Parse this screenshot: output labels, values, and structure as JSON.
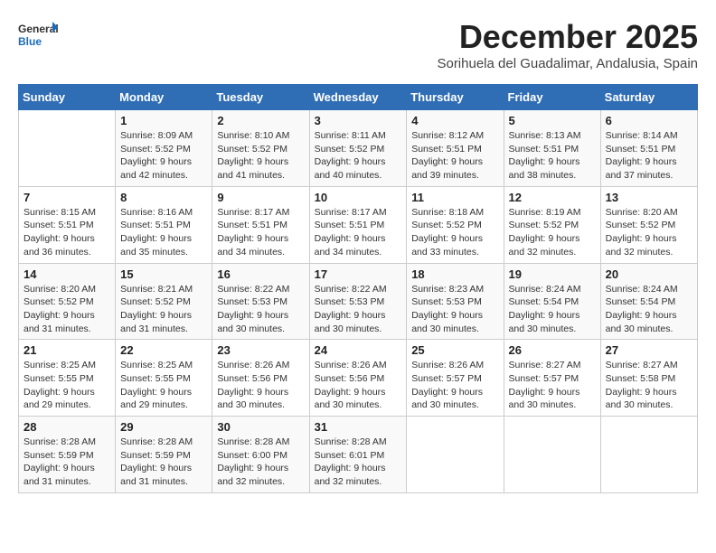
{
  "header": {
    "logo_general": "General",
    "logo_blue": "Blue",
    "month_title": "December 2025",
    "subtitle": "Sorihuela del Guadalimar, Andalusia, Spain"
  },
  "columns": [
    "Sunday",
    "Monday",
    "Tuesday",
    "Wednesday",
    "Thursday",
    "Friday",
    "Saturday"
  ],
  "weeks": [
    [
      {
        "day": "",
        "info": ""
      },
      {
        "day": "1",
        "info": "Sunrise: 8:09 AM\nSunset: 5:52 PM\nDaylight: 9 hours\nand 42 minutes."
      },
      {
        "day": "2",
        "info": "Sunrise: 8:10 AM\nSunset: 5:52 PM\nDaylight: 9 hours\nand 41 minutes."
      },
      {
        "day": "3",
        "info": "Sunrise: 8:11 AM\nSunset: 5:52 PM\nDaylight: 9 hours\nand 40 minutes."
      },
      {
        "day": "4",
        "info": "Sunrise: 8:12 AM\nSunset: 5:51 PM\nDaylight: 9 hours\nand 39 minutes."
      },
      {
        "day": "5",
        "info": "Sunrise: 8:13 AM\nSunset: 5:51 PM\nDaylight: 9 hours\nand 38 minutes."
      },
      {
        "day": "6",
        "info": "Sunrise: 8:14 AM\nSunset: 5:51 PM\nDaylight: 9 hours\nand 37 minutes."
      }
    ],
    [
      {
        "day": "7",
        "info": "Sunrise: 8:15 AM\nSunset: 5:51 PM\nDaylight: 9 hours\nand 36 minutes."
      },
      {
        "day": "8",
        "info": "Sunrise: 8:16 AM\nSunset: 5:51 PM\nDaylight: 9 hours\nand 35 minutes."
      },
      {
        "day": "9",
        "info": "Sunrise: 8:17 AM\nSunset: 5:51 PM\nDaylight: 9 hours\nand 34 minutes."
      },
      {
        "day": "10",
        "info": "Sunrise: 8:17 AM\nSunset: 5:51 PM\nDaylight: 9 hours\nand 34 minutes."
      },
      {
        "day": "11",
        "info": "Sunrise: 8:18 AM\nSunset: 5:52 PM\nDaylight: 9 hours\nand 33 minutes."
      },
      {
        "day": "12",
        "info": "Sunrise: 8:19 AM\nSunset: 5:52 PM\nDaylight: 9 hours\nand 32 minutes."
      },
      {
        "day": "13",
        "info": "Sunrise: 8:20 AM\nSunset: 5:52 PM\nDaylight: 9 hours\nand 32 minutes."
      }
    ],
    [
      {
        "day": "14",
        "info": "Sunrise: 8:20 AM\nSunset: 5:52 PM\nDaylight: 9 hours\nand 31 minutes."
      },
      {
        "day": "15",
        "info": "Sunrise: 8:21 AM\nSunset: 5:52 PM\nDaylight: 9 hours\nand 31 minutes."
      },
      {
        "day": "16",
        "info": "Sunrise: 8:22 AM\nSunset: 5:53 PM\nDaylight: 9 hours\nand 30 minutes."
      },
      {
        "day": "17",
        "info": "Sunrise: 8:22 AM\nSunset: 5:53 PM\nDaylight: 9 hours\nand 30 minutes."
      },
      {
        "day": "18",
        "info": "Sunrise: 8:23 AM\nSunset: 5:53 PM\nDaylight: 9 hours\nand 30 minutes."
      },
      {
        "day": "19",
        "info": "Sunrise: 8:24 AM\nSunset: 5:54 PM\nDaylight: 9 hours\nand 30 minutes."
      },
      {
        "day": "20",
        "info": "Sunrise: 8:24 AM\nSunset: 5:54 PM\nDaylight: 9 hours\nand 30 minutes."
      }
    ],
    [
      {
        "day": "21",
        "info": "Sunrise: 8:25 AM\nSunset: 5:55 PM\nDaylight: 9 hours\nand 29 minutes."
      },
      {
        "day": "22",
        "info": "Sunrise: 8:25 AM\nSunset: 5:55 PM\nDaylight: 9 hours\nand 29 minutes."
      },
      {
        "day": "23",
        "info": "Sunrise: 8:26 AM\nSunset: 5:56 PM\nDaylight: 9 hours\nand 30 minutes."
      },
      {
        "day": "24",
        "info": "Sunrise: 8:26 AM\nSunset: 5:56 PM\nDaylight: 9 hours\nand 30 minutes."
      },
      {
        "day": "25",
        "info": "Sunrise: 8:26 AM\nSunset: 5:57 PM\nDaylight: 9 hours\nand 30 minutes."
      },
      {
        "day": "26",
        "info": "Sunrise: 8:27 AM\nSunset: 5:57 PM\nDaylight: 9 hours\nand 30 minutes."
      },
      {
        "day": "27",
        "info": "Sunrise: 8:27 AM\nSunset: 5:58 PM\nDaylight: 9 hours\nand 30 minutes."
      }
    ],
    [
      {
        "day": "28",
        "info": "Sunrise: 8:28 AM\nSunset: 5:59 PM\nDaylight: 9 hours\nand 31 minutes."
      },
      {
        "day": "29",
        "info": "Sunrise: 8:28 AM\nSunset: 5:59 PM\nDaylight: 9 hours\nand 31 minutes."
      },
      {
        "day": "30",
        "info": "Sunrise: 8:28 AM\nSunset: 6:00 PM\nDaylight: 9 hours\nand 32 minutes."
      },
      {
        "day": "31",
        "info": "Sunrise: 8:28 AM\nSunset: 6:01 PM\nDaylight: 9 hours\nand 32 minutes."
      },
      {
        "day": "",
        "info": ""
      },
      {
        "day": "",
        "info": ""
      },
      {
        "day": "",
        "info": ""
      }
    ]
  ]
}
